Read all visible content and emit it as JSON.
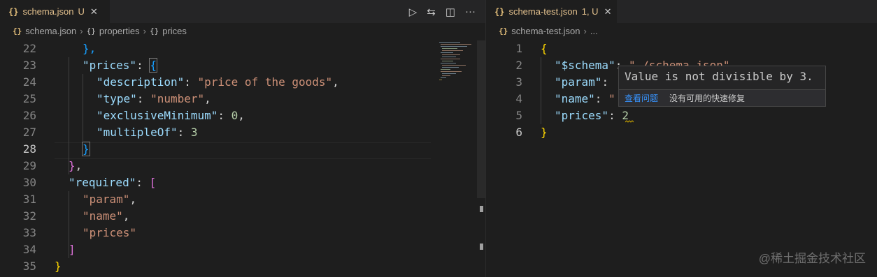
{
  "left": {
    "tab": {
      "icon": "{}",
      "name": "schema.json",
      "mark": "U",
      "close": "✕"
    },
    "actions": [
      "play-icon",
      "compare-changes-icon",
      "split-editor-icon",
      "more-actions-icon"
    ],
    "actions_glyphs": [
      "▷",
      "⇆",
      "◫",
      "···"
    ],
    "breadcrumb": [
      "schema.json",
      "properties",
      "prices"
    ],
    "breadcrumb_icon": "{}",
    "line_numbers": [
      "22",
      "23",
      "24",
      "25",
      "26",
      "27",
      "28",
      "29",
      "30",
      "31",
      "32",
      "33",
      "34",
      "35"
    ],
    "current_line": "28"
  },
  "right": {
    "tab": {
      "icon": "{}",
      "name": "schema-test.json",
      "mark": "1, U",
      "close": "✕"
    },
    "breadcrumb": [
      "schema-test.json",
      "..."
    ],
    "breadcrumb_icon": "{}",
    "line_numbers": [
      "1",
      "2",
      "3",
      "4",
      "5",
      "6"
    ],
    "hover": {
      "message": "Value is not divisible by 3.",
      "view_problem": "查看问题",
      "no_fix": "没有可用的快速修复"
    }
  },
  "watermark": "@稀土掘金技术社区",
  "colors": {
    "key": "#9cdcfe",
    "string": "#ce9178",
    "number": "#b5cea8",
    "bracket_gold": "#ffd700",
    "bracket_pink": "#da70d6",
    "bracket_blue": "#179fff",
    "warning": "#cca700"
  },
  "code_left": {
    "l22": [
      "},"
    ],
    "l23": [
      "\"prices\"",
      ": ",
      "{"
    ],
    "l24": [
      "\"description\"",
      ": ",
      "\"price of the goods\"",
      ","
    ],
    "l25": [
      "\"type\"",
      ": ",
      "\"number\"",
      ","
    ],
    "l26": [
      "\"exclusiveMinimum\"",
      ": ",
      "0",
      ","
    ],
    "l27": [
      "\"multipleOf\"",
      ": ",
      "3"
    ],
    "l28": [
      "}"
    ],
    "l29": [
      "}",
      ","
    ],
    "l30": [
      "\"required\"",
      ": ",
      "["
    ],
    "l31": [
      "\"param\"",
      ","
    ],
    "l32": [
      "\"name\"",
      ","
    ],
    "l33": [
      "\"prices\""
    ],
    "l34": [
      "]"
    ],
    "l35": [
      "}"
    ]
  },
  "code_right": {
    "l1": [
      "{"
    ],
    "l2": [
      "\"$schema\"",
      ": ",
      "\"./schema.json\""
    ],
    "l3": [
      "\"param\"",
      ": "
    ],
    "l4": [
      "\"name\"",
      ": ",
      "\""
    ],
    "l5": [
      "\"prices\"",
      ": ",
      "2"
    ],
    "l6": [
      "}"
    ]
  }
}
